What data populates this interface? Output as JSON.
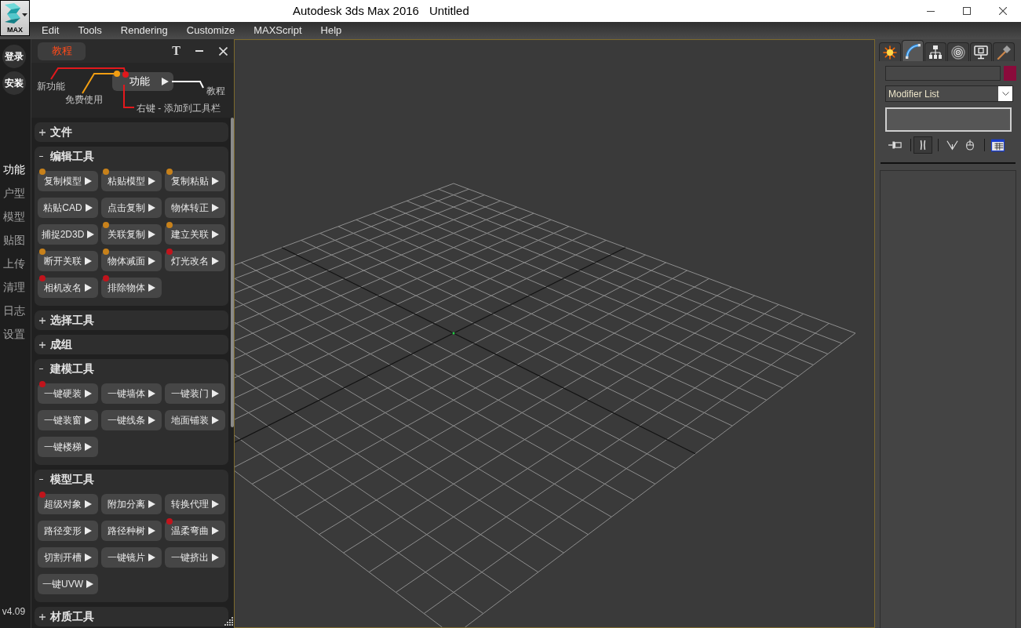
{
  "window": {
    "logo_label": "MAX",
    "title": "Autodesk 3ds Max 2016",
    "document": "Untitled"
  },
  "menu_bar": [
    "Edit",
    "Tools",
    "Rendering",
    "Customize",
    "MAXScript",
    "Help"
  ],
  "sidebar": {
    "account_buttons": [
      "登录",
      "安装"
    ],
    "items": [
      {
        "label": "功能",
        "selected": true
      },
      {
        "label": "户型",
        "selected": false
      },
      {
        "label": "模型",
        "selected": false
      },
      {
        "label": "贴图",
        "selected": false
      },
      {
        "label": "上传",
        "selected": false
      },
      {
        "label": "清理",
        "selected": false
      },
      {
        "label": "日志",
        "selected": false
      },
      {
        "label": "设置",
        "selected": false
      }
    ],
    "version": "v4.09"
  },
  "tool_panel": {
    "tab": "教程",
    "font_button": "T",
    "legend": {
      "button_label": "功能",
      "callouts": [
        {
          "text": "新功能",
          "color": "#e3181c"
        },
        {
          "text": "免费使用",
          "color": "#f29e12"
        },
        {
          "text": "教程",
          "color": "#ffffff"
        },
        {
          "text": "右键 - 添加到工具栏",
          "color": "#e3181c"
        }
      ]
    },
    "sections": [
      {
        "title": "文件",
        "expanded": false
      },
      {
        "title": "编辑工具",
        "expanded": true,
        "tools": [
          {
            "label": "复制模型",
            "color": "#c7811b"
          },
          {
            "label": "粘贴模型",
            "color": "#c7811b"
          },
          {
            "label": "复制粘贴",
            "color": "#c7811b"
          },
          {
            "label": "粘贴CAD"
          },
          {
            "label": "点击复制"
          },
          {
            "label": "物体转正"
          },
          {
            "label": "捕捉2D3D"
          },
          {
            "label": "关联复制",
            "color": "#c7811b"
          },
          {
            "label": "建立关联",
            "color": "#c7811b"
          },
          {
            "label": "断开关联",
            "color": "#c7811b"
          },
          {
            "label": "物体减面",
            "color": "#c7811b"
          },
          {
            "label": "灯光改名",
            "color": "#c0141c"
          },
          {
            "label": "相机改名",
            "color": "#c0141c"
          },
          {
            "label": "排除物体",
            "color": "#c0141c"
          }
        ]
      },
      {
        "title": "选择工具",
        "expanded": false
      },
      {
        "title": "成组",
        "expanded": false
      },
      {
        "title": "建模工具",
        "expanded": true,
        "tools": [
          {
            "label": "一键硬装",
            "color": "#c0141c"
          },
          {
            "label": "一键墙体"
          },
          {
            "label": "一键装门"
          },
          {
            "label": "一键装窗"
          },
          {
            "label": "一键线条"
          },
          {
            "label": "地面铺装"
          },
          {
            "label": "一键楼梯"
          }
        ]
      },
      {
        "title": "模型工具",
        "expanded": true,
        "tools": [
          {
            "label": "超级对象",
            "color": "#c0141c"
          },
          {
            "label": "附加分离"
          },
          {
            "label": "转换代理"
          },
          {
            "label": "路径变形"
          },
          {
            "label": "路径种树"
          },
          {
            "label": "温柔弯曲",
            "color": "#c0141c"
          },
          {
            "label": "切割开槽"
          },
          {
            "label": "一键镜片"
          },
          {
            "label": "一键挤出"
          },
          {
            "label": "一键UVW"
          }
        ]
      },
      {
        "title": "材质工具",
        "expanded": false
      }
    ]
  },
  "command_panel": {
    "tabs": [
      {
        "selected": false
      },
      {
        "selected": true
      },
      {
        "selected": false
      },
      {
        "selected": false
      },
      {
        "selected": false
      },
      {
        "selected": false
      }
    ],
    "modifier_list": "Modifier List",
    "stack_tools": [
      {
        "on": false
      },
      {
        "on": true
      },
      {
        "on": false
      },
      {
        "on": false
      },
      {
        "on": false
      }
    ]
  }
}
